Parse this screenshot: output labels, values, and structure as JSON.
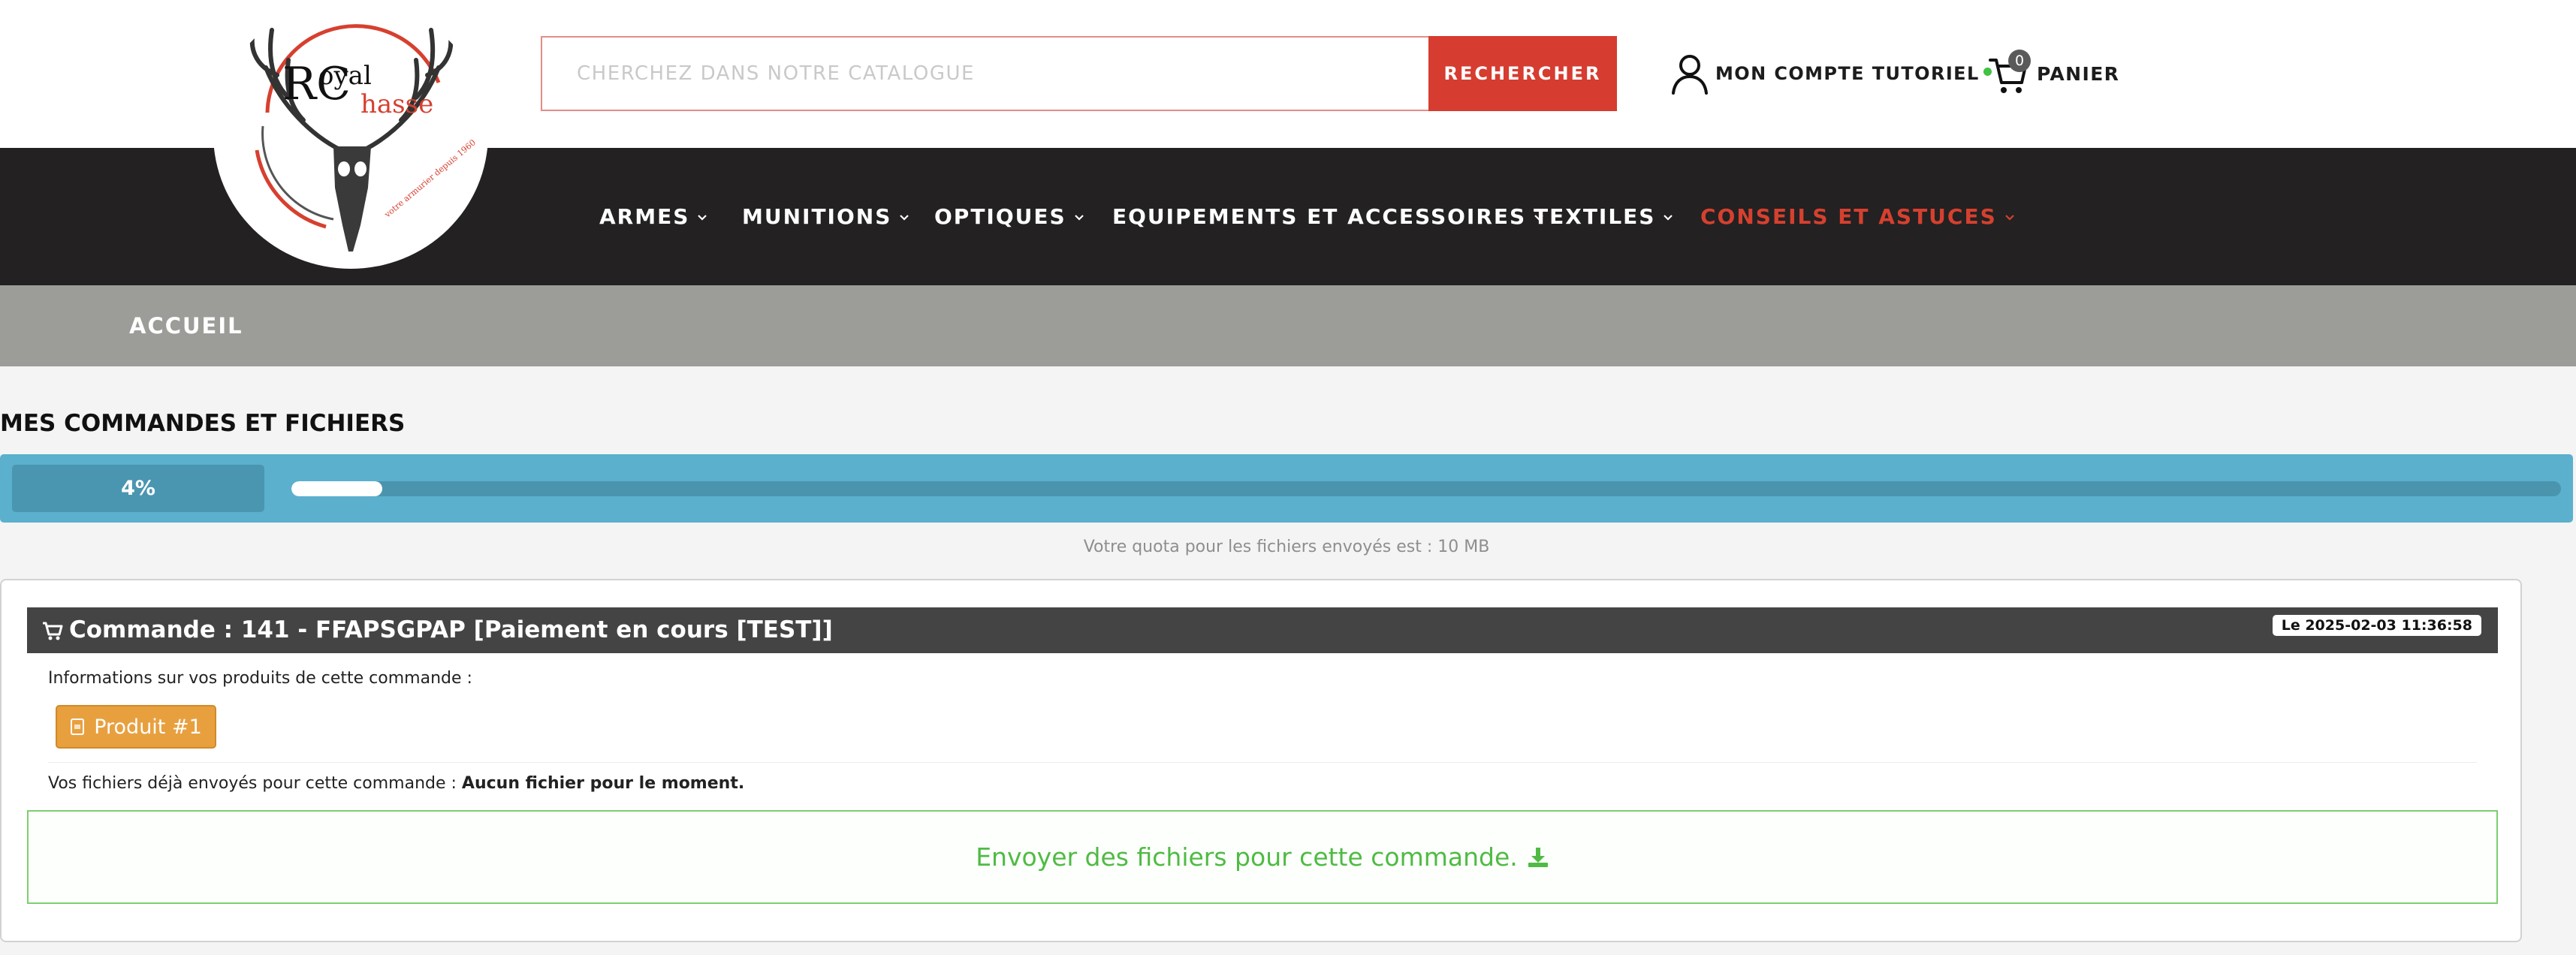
{
  "logo": {
    "brand_letters": "RC",
    "brand_word_1": "oyal",
    "brand_word_2": "hasse",
    "tagline": "votre armurier depuis 1960"
  },
  "search": {
    "placeholder": "CHERCHEZ DANS NOTRE CATALOGUE",
    "value": "",
    "button_label": "RECHERCHER"
  },
  "account": {
    "label": "MON COMPTE TUTORIEL",
    "status_color": "#41c241"
  },
  "cart": {
    "count": "0",
    "label": "PANIER"
  },
  "nav": {
    "items": [
      {
        "label": "ARMES"
      },
      {
        "label": "MUNITIONS"
      },
      {
        "label": "OPTIQUES"
      },
      {
        "label": "EQUIPEMENTS ET ACCESSOIRES"
      },
      {
        "label": "TEXTILES"
      },
      {
        "label": "CONSEILS ET ASTUCES",
        "active": true
      }
    ],
    "active_color": "#d6402f"
  },
  "breadcrumb": {
    "home": "ACCUEIL"
  },
  "page": {
    "title": "MES COMMANDES ET FICHIERS"
  },
  "quota": {
    "percent_label": "4%",
    "percent": 4,
    "note": "Votre quota pour les fichiers envoyés est : 10 MB"
  },
  "order": {
    "title": "Commande : 141 - FFAPSGPAP [Paiement en cours [TEST]]",
    "date": "Le 2025-02-03 11:36:58",
    "products_info": "Informations sur vos produits de cette commande :",
    "product_button": "Produit #1",
    "files_prefix": "Vos fichiers déjà envoyés pour cette commande :",
    "files_status": "Aucun fichier pour le moment.",
    "upload_label": "Envoyer des fichiers pour cette commande."
  },
  "colors": {
    "accent_red": "#d63c30",
    "nav_bg": "#232122",
    "breadcrumb_bg": "#9c9d99",
    "quota_bg": "#5ab0cd",
    "product_orange": "#e8a03f",
    "upload_green": "#4fbb44"
  },
  "icons": {
    "account": "user-outline-icon",
    "cart": "shopping-cart-icon",
    "chevron": "chevron-down-icon",
    "order": "cart-small-icon",
    "product": "document-icon",
    "upload": "download-icon"
  }
}
